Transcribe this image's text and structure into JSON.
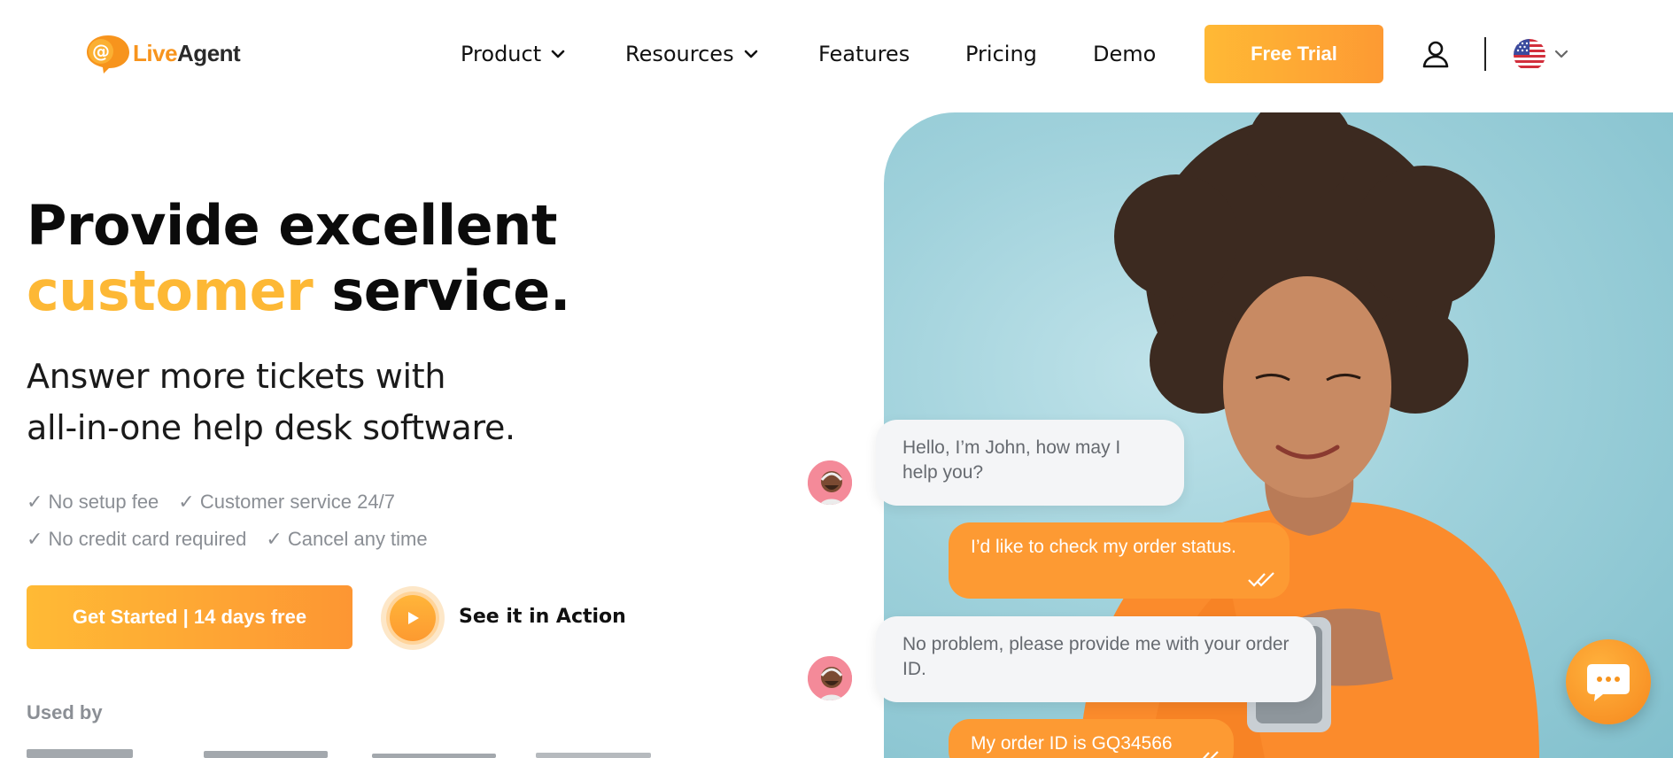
{
  "brand": {
    "live": "Live",
    "agent": "Agent"
  },
  "nav": {
    "product": "Product",
    "resources": "Resources",
    "features": "Features",
    "pricing": "Pricing",
    "demo": "Demo",
    "free_trial": "Free Trial"
  },
  "hero": {
    "title_line1": "Provide excellent",
    "title_accent": "customer",
    "title_rest": " service.",
    "sub_line1": "Answer more tickets with",
    "sub_line2": "all-in-one help desk software.",
    "checks": [
      "✓ No setup fee",
      "✓ Customer service 24/7",
      "✓ No credit card required",
      "✓ Cancel any time"
    ],
    "cta_primary": "Get Started | 14 days free",
    "cta_secondary": "See it in Action",
    "used_by": "Used by"
  },
  "chat": {
    "messages": [
      {
        "from": "agent",
        "text": "Hello, I’m John, how may I help you?"
      },
      {
        "from": "user",
        "text": "I’d like to check my order status."
      },
      {
        "from": "agent",
        "text": "No problem, please provide me with your order ID."
      },
      {
        "from": "user",
        "text": "My order ID is GQ34566"
      }
    ]
  },
  "colors": {
    "accent": "#fdb835",
    "orange": "#fd9a33",
    "text": "#0b0b0b",
    "muted": "#8a8e94",
    "photo_bg": "#9fd1db"
  },
  "icons": {
    "logo": "at-speech-bubble-icon",
    "chevron": "chevron-down-icon",
    "user": "user-icon",
    "flag": "us-flag-icon",
    "play": "play-icon",
    "ticks": "double-check-icon",
    "chat": "chat-bubble-dots-icon"
  }
}
